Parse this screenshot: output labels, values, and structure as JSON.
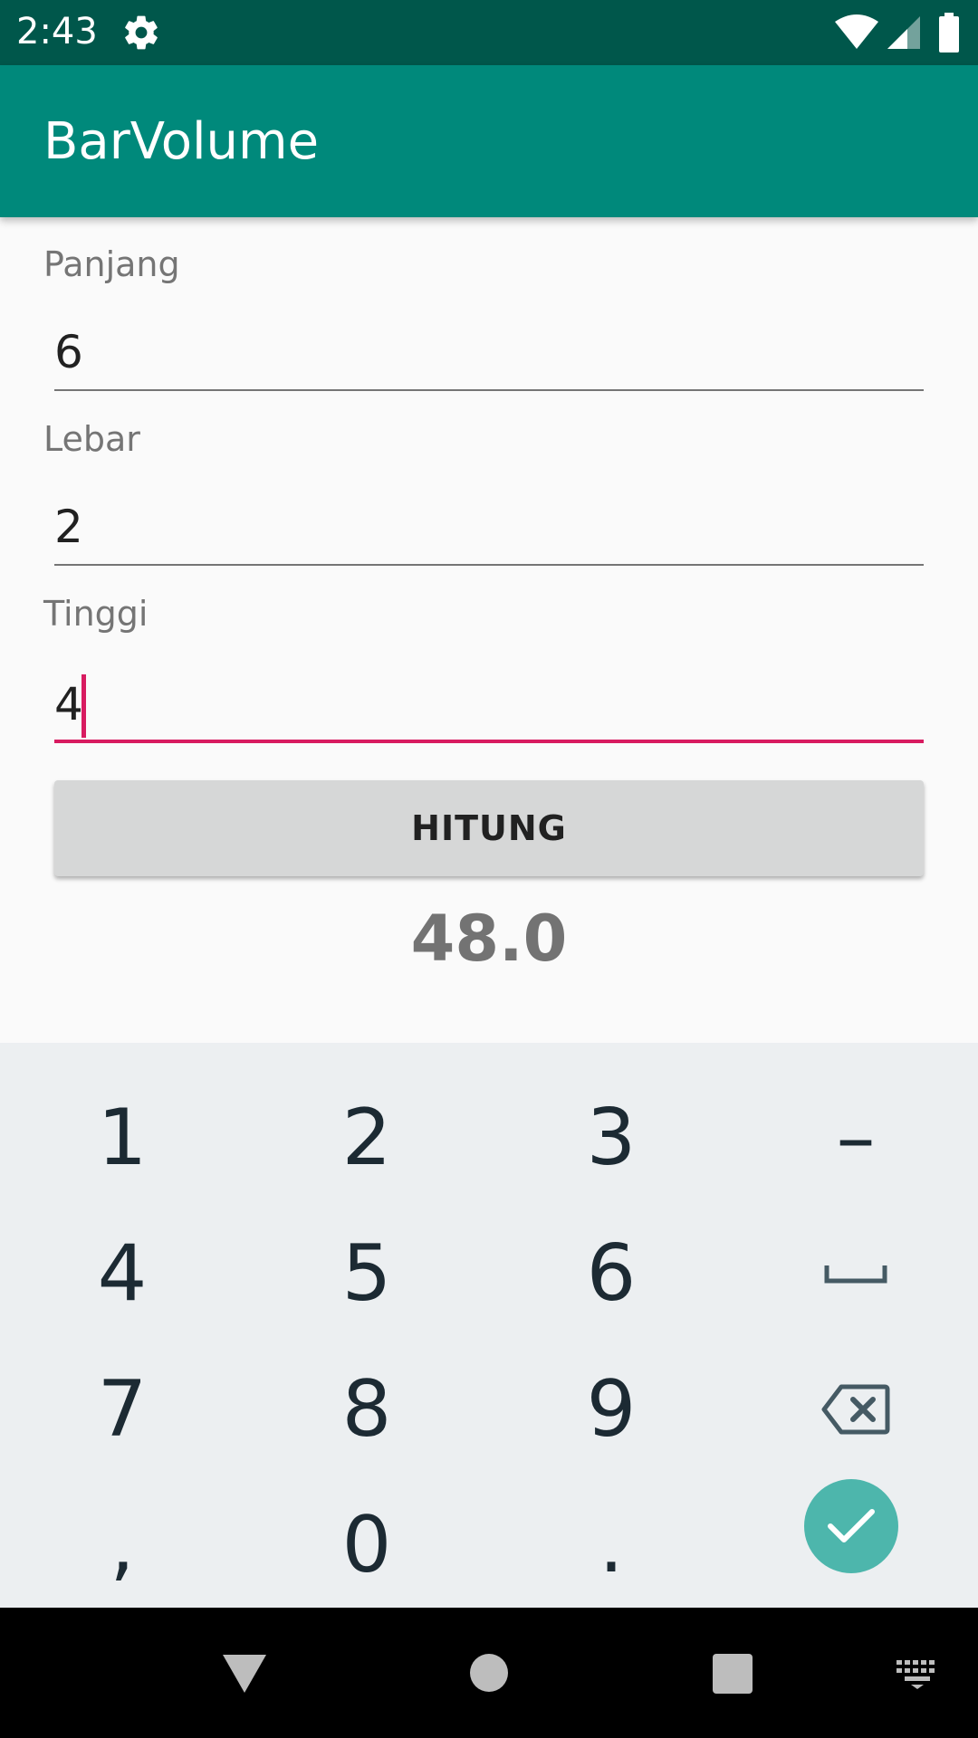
{
  "status_bar": {
    "time": "2:43",
    "icons": [
      "gear-icon",
      "wifi-icon",
      "signal-icon",
      "battery-icon"
    ]
  },
  "app_bar": {
    "title": "BarVolume"
  },
  "form": {
    "panjang": {
      "label": "Panjang",
      "value": "6"
    },
    "lebar": {
      "label": "Lebar",
      "value": "2"
    },
    "tinggi": {
      "label": "Tinggi",
      "value": "4"
    }
  },
  "button": {
    "label": "HITUNG"
  },
  "result": "48.0",
  "keyboard": {
    "keys": [
      "1",
      "2",
      "3",
      "–",
      "4",
      "5",
      "6",
      "7",
      "8",
      "9",
      ",",
      "0",
      "."
    ],
    "special": [
      "space-icon",
      "backspace-icon",
      "done-check-icon"
    ]
  },
  "nav_bar": {
    "icons": [
      "back-icon",
      "home-icon",
      "recents-icon",
      "keyboard-switch-icon"
    ]
  },
  "colors": {
    "status_bar": "#00574b",
    "app_bar": "#00897b",
    "accent": "#d81b60",
    "done_button": "#4db6ac",
    "keyboard_bg": "#eceff1"
  }
}
